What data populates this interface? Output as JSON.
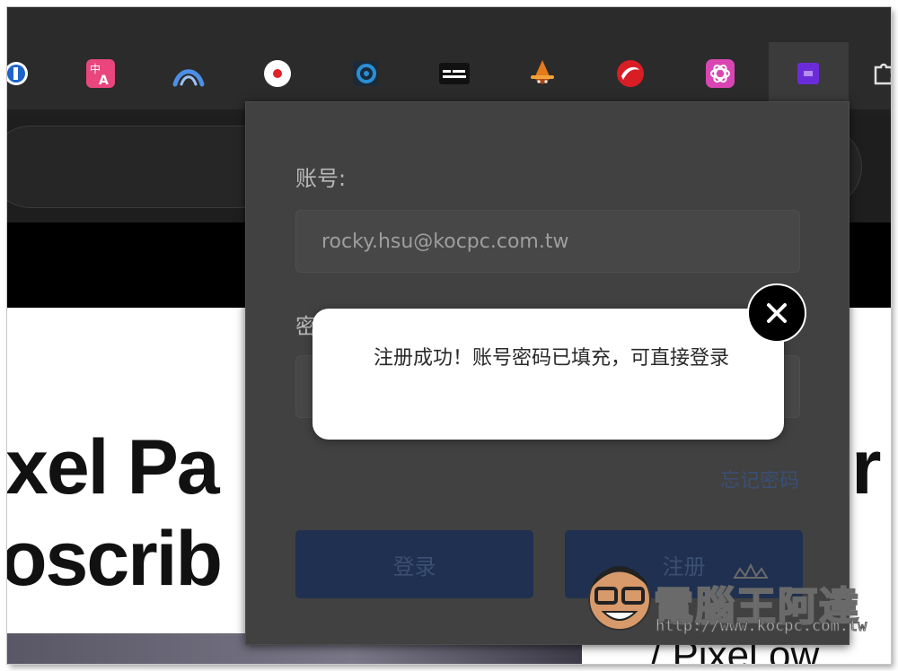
{
  "colors": {
    "toolbar_bg": "#2b2b2b",
    "popup_bg": "#414141",
    "button_bg": "#1f3050",
    "button_text": "#3b4f72",
    "link": "#3a4f74",
    "toast_bg": "#ffffff"
  },
  "toolbar": {
    "extensions": [
      {
        "name": "partial-blue-extension-icon"
      },
      {
        "name": "translate-extension-icon"
      },
      {
        "name": "mountain-arc-extension-icon"
      },
      {
        "name": "red-dot-record-extension-icon"
      },
      {
        "name": "blue-ring-extension-icon"
      },
      {
        "name": "keyboard-extension-icon"
      },
      {
        "name": "witch-hat-extension-icon"
      },
      {
        "name": "red-swirl-extension-icon"
      },
      {
        "name": "openai-extension-icon"
      },
      {
        "name": "purple-square-extension-icon",
        "active": true
      },
      {
        "name": "puzzle-extension-icon"
      }
    ]
  },
  "page_behind": {
    "headline_line1": "xel Pa",
    "headline_tail": "r",
    "headline_line2": "oscrib",
    "sub_text": "/ Pixel ow"
  },
  "popup": {
    "account_label": "账号:",
    "account_value": "rocky.hsu@kocpc.com.tw",
    "password_label": "密",
    "forgot_link": "忘记密码",
    "login_button": "登录",
    "register_button": "注册"
  },
  "toast": {
    "message": "注册成功！账号密码已填充，可直接登录",
    "close_icon": "close-icon"
  },
  "watermark": {
    "text": "電腦王阿達",
    "url": "http://www.kocpc.com.tw"
  }
}
